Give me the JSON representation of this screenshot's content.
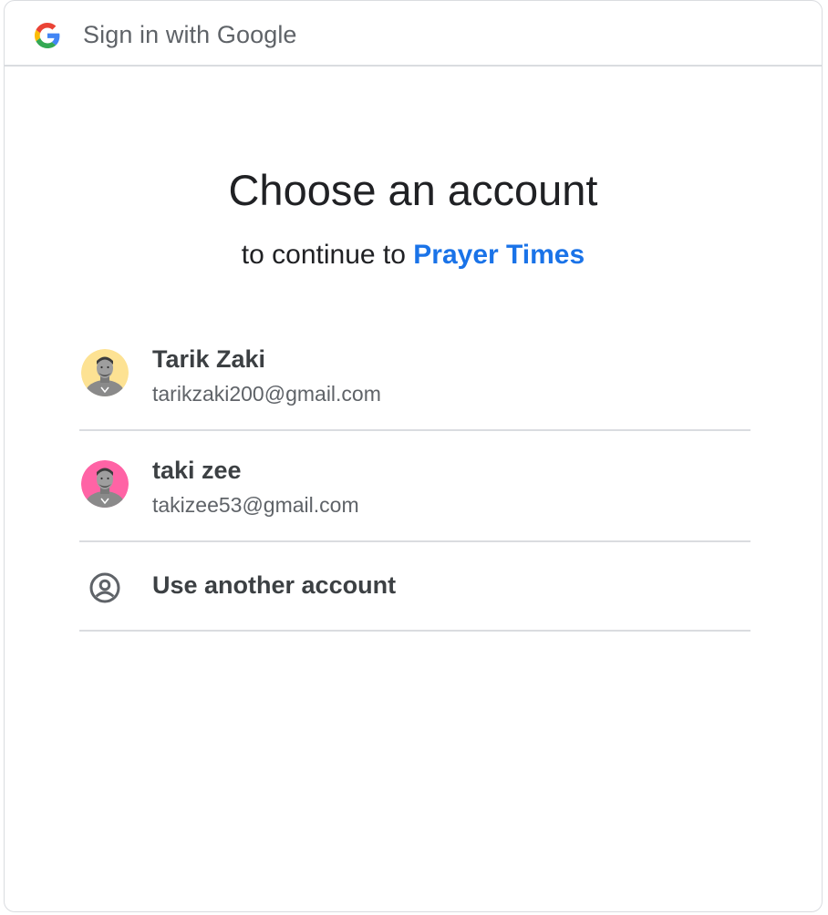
{
  "header": {
    "title": "Sign in with Google",
    "logo_icon": "google-g-icon"
  },
  "main": {
    "title": "Choose an account",
    "subtitle_prefix": "to continue to ",
    "app_name": "Prayer Times"
  },
  "accounts": [
    {
      "name": "Tarik Zaki",
      "email": "tarikzaki200@gmail.com",
      "avatar_bg": "#fde293",
      "avatar_icon": "profile-photo-avatar"
    },
    {
      "name": "taki zee",
      "email": "takizee53@gmail.com",
      "avatar_bg": "#ff63a5",
      "avatar_icon": "profile-photo-avatar"
    }
  ],
  "other_account": {
    "label": "Use another account",
    "icon": "account-circle-icon"
  },
  "colors": {
    "accent": "#1a73e8",
    "text_primary": "#202124",
    "text_secondary": "#5f6368",
    "divider": "#dadce0"
  }
}
